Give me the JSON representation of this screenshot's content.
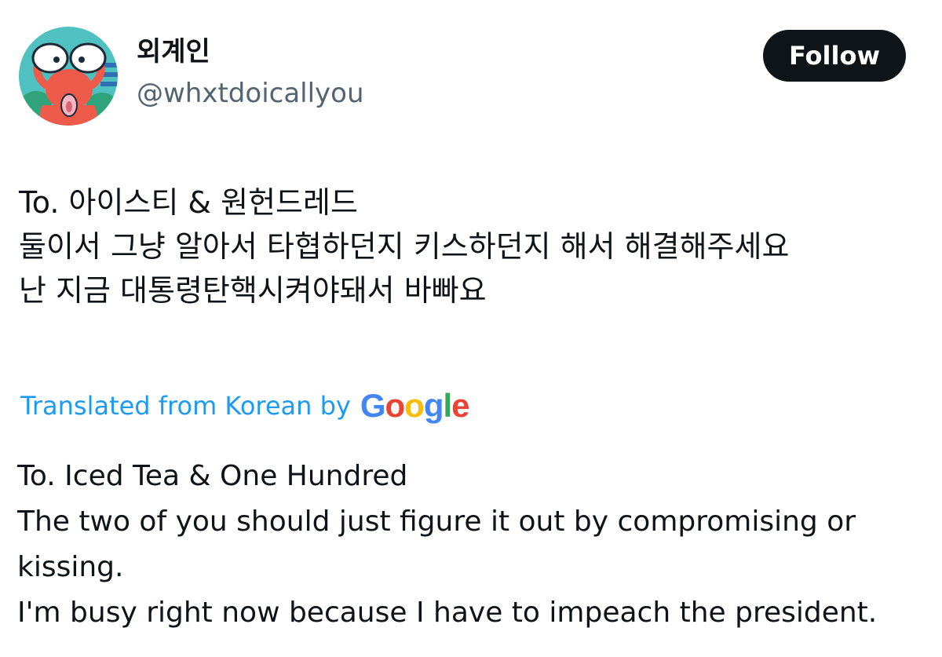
{
  "user": {
    "display_name": "외계인",
    "handle": "@whxtdoicallyou",
    "avatar_icon": "octopus-avatar-icon"
  },
  "follow_button": {
    "label": "Follow"
  },
  "tweet": {
    "original_lines": [
      "To. 아이스티 & 원헌드레드",
      "둘이서 그냥 알아서 타협하던지 키스하던지 해서 해결해주세요",
      "난 지금 대통령탄핵시켜야돼서 바빠요"
    ],
    "translated_by_label": "Translated from Korean by",
    "translator_logo": "Google",
    "translation_lines": [
      "To. Iced Tea & One Hundred",
      "The two of you should just figure it out by compromising or",
      "kissing.",
      "I'm busy right now because I have to impeach the president."
    ]
  },
  "colors": {
    "link_blue": "#1d9bf0",
    "text_primary": "#0f1419",
    "text_secondary": "#536471",
    "button_bg": "#0f1419"
  }
}
